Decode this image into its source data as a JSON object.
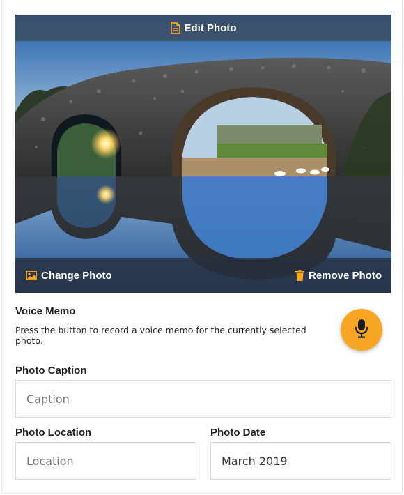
{
  "photo": {
    "edit_label": "Edit Photo",
    "change_label": "Change Photo",
    "remove_label": "Remove Photo",
    "edit_icon": "document-icon",
    "change_icon": "image-icon",
    "remove_icon": "trash-icon"
  },
  "voice_memo": {
    "title": "Voice Memo",
    "description": "Press the button to record a voice memo for the currently selected photo.",
    "button_icon": "microphone-icon"
  },
  "fields": {
    "caption": {
      "label": "Photo Caption",
      "value": "",
      "placeholder": "Caption"
    },
    "location": {
      "label": "Photo Location",
      "value": "",
      "placeholder": "Location"
    },
    "date": {
      "label": "Photo Date",
      "value": "March 2019"
    }
  },
  "colors": {
    "accent": "#f6a623",
    "overlay": "#3c4e64",
    "border": "#d6d6d6"
  }
}
